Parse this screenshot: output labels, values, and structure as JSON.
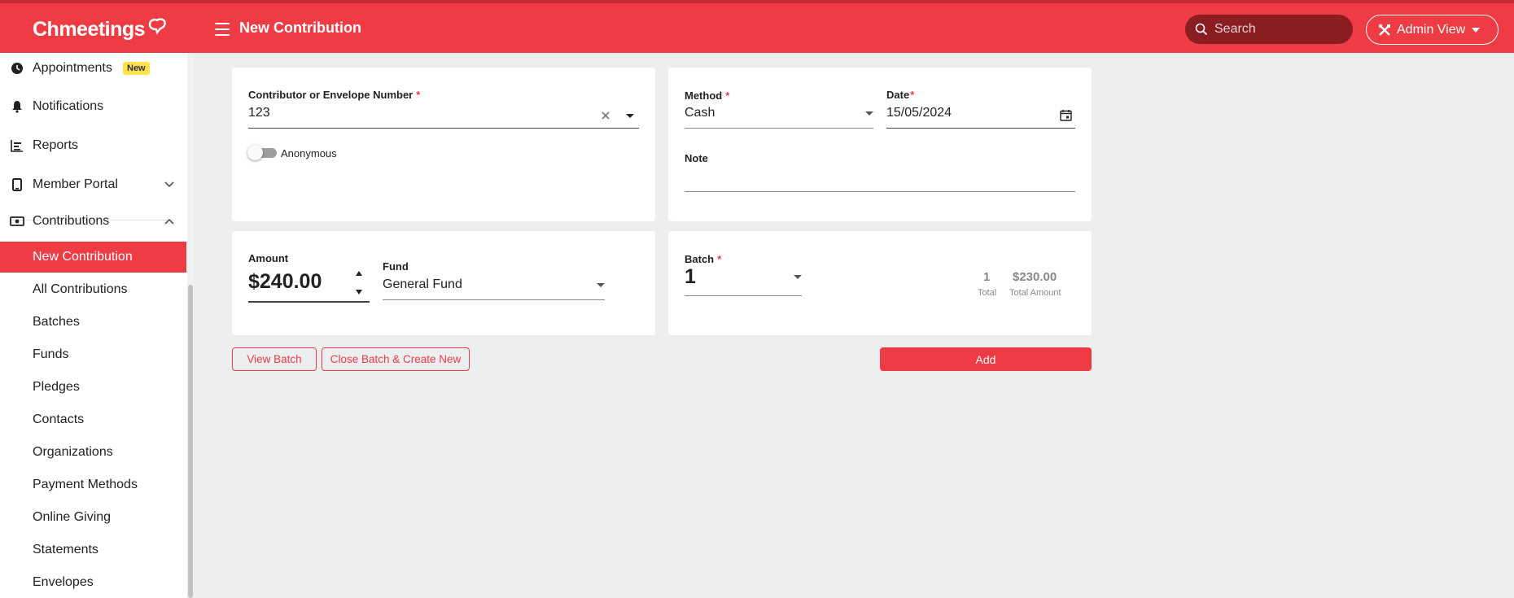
{
  "brand": {
    "name": "Chmeetings",
    "accent": "#ef3b44"
  },
  "header": {
    "title": "New Contribution",
    "search_placeholder": "Search",
    "admin_view_label": "Admin View"
  },
  "sidebar": {
    "items": [
      {
        "label": "Appointments",
        "icon": "clock-icon",
        "badge": "New"
      },
      {
        "label": "Notifications",
        "icon": "bell-icon"
      },
      {
        "label": "Reports",
        "icon": "bar-chart-icon"
      },
      {
        "label": "Member Portal",
        "icon": "mobile-icon",
        "chevron": "chevron-down-icon"
      },
      {
        "label": "Contributions",
        "icon": "money-icon",
        "chevron": "chevron-up-icon"
      },
      {
        "label": "New Contribution",
        "active": true
      },
      {
        "label": "All Contributions"
      },
      {
        "label": "Batches"
      },
      {
        "label": "Funds"
      },
      {
        "label": "Pledges"
      },
      {
        "label": "Contacts"
      },
      {
        "label": "Organizations"
      },
      {
        "label": "Payment Methods"
      },
      {
        "label": "Online Giving"
      },
      {
        "label": "Statements"
      },
      {
        "label": "Envelopes"
      }
    ]
  },
  "form": {
    "contributor": {
      "label": "Contributor or Envelope Number",
      "required_mark": "*",
      "value": "123"
    },
    "anonymous": {
      "label": "Anonymous",
      "checked": false
    },
    "method": {
      "label": "Method",
      "required_mark": "*",
      "value": "Cash"
    },
    "date": {
      "label": "Date",
      "required_mark": "*",
      "value": "15/05/2024"
    },
    "note": {
      "label": "Note",
      "value": ""
    },
    "amount": {
      "label": "Amount",
      "value": "$240.00"
    },
    "fund": {
      "label": "Fund",
      "value": "General Fund"
    },
    "batch": {
      "label": "Batch",
      "required_mark": "*",
      "value": "1",
      "total_count": "1",
      "total_count_label": "Total",
      "total_amount": "$230.00",
      "total_amount_label": "Total Amount"
    }
  },
  "actions": {
    "view_batch": "View Batch",
    "close_batch": "Close Batch & Create New",
    "add": "Add"
  }
}
